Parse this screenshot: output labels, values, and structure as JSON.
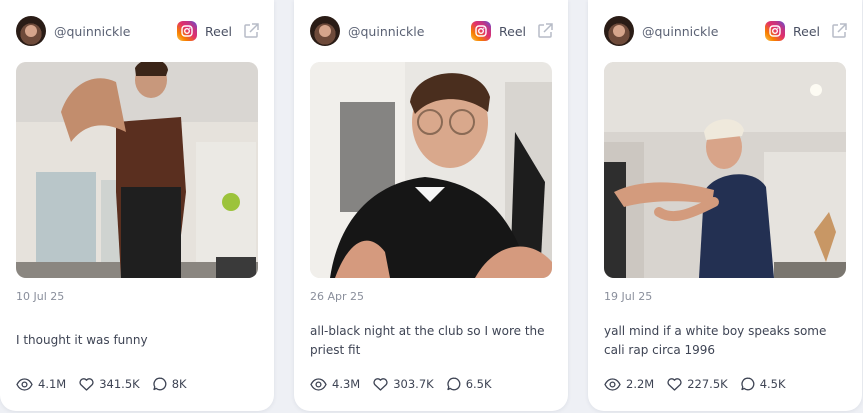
{
  "posts": [
    {
      "username": "@quinnickle",
      "platform_icon": "instagram-icon",
      "type_label": "Reel",
      "date": "10 Jul 25",
      "caption": "I thought it was funny",
      "views": "4.1M",
      "likes": "341.5K",
      "comments": "8K"
    },
    {
      "username": "@quinnickle",
      "platform_icon": "instagram-icon",
      "type_label": "Reel",
      "date": "26 Apr 25",
      "caption": "all-black night at the club so I wore the priest fit",
      "views": "4.3M",
      "likes": "303.7K",
      "comments": "6.5K"
    },
    {
      "username": "@quinnickle",
      "platform_icon": "instagram-icon",
      "type_label": "Reel",
      "date": "19 Jul 25",
      "caption": "yall mind if a white boy speaks some cali rap circa 1996",
      "views": "2.2M",
      "likes": "227.5K",
      "comments": "4.5K"
    }
  ]
}
